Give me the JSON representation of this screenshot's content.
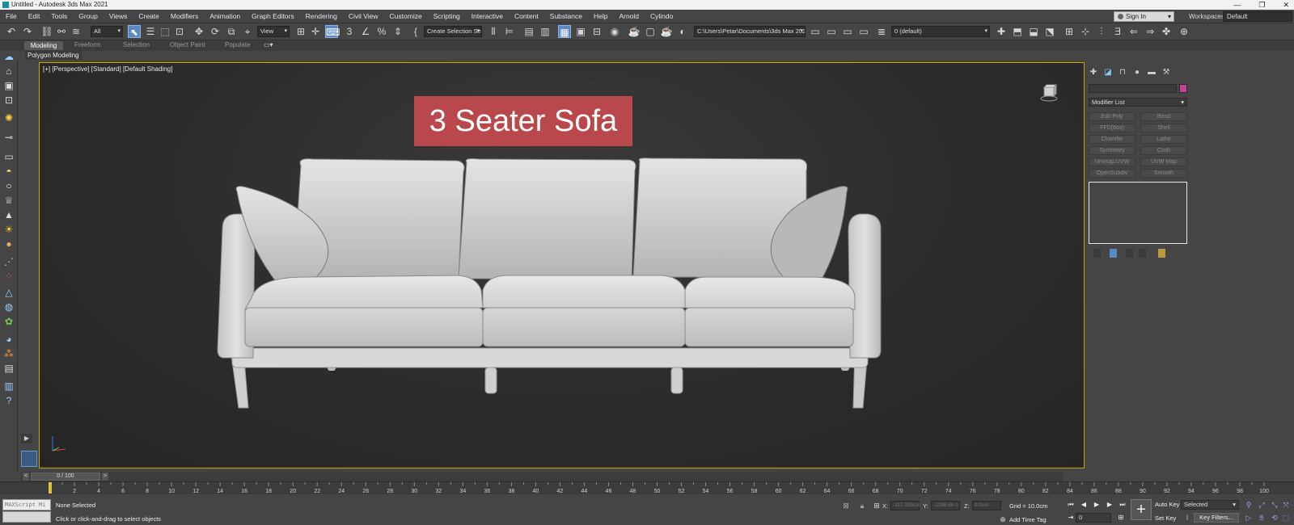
{
  "title_bar": {
    "title": "Untitled - Autodesk 3ds Max 2021",
    "minimize": "—",
    "restore": "❐",
    "close": "✕"
  },
  "menu": [
    "File",
    "Edit",
    "Tools",
    "Group",
    "Views",
    "Create",
    "Modifiers",
    "Animation",
    "Graph Editors",
    "Rendering",
    "Civil View",
    "Customize",
    "Scripting",
    "Interactive",
    "Content",
    "Substance",
    "Help",
    "Arnold",
    "Cylindo"
  ],
  "account": {
    "sign_in": "Sign In",
    "workspaces_label": "Workspaces:",
    "workspace": "Default"
  },
  "toolbar": {
    "selection_filter": "All",
    "ref_coord": "View",
    "named_selection": "Create Selection Se",
    "project_path": "C:\\Users\\Petar\\Documents\\3ds Max 2021",
    "layer": "0 (default)",
    "snap_label": "3",
    "angle_snap_label": "∠",
    "percent_snap_label": "%"
  },
  "ribbon": {
    "tabs": [
      "Modeling",
      "Freeform",
      "Selection",
      "Object Paint",
      "Populate"
    ],
    "sub_label": "Polygon Modeling"
  },
  "viewport": {
    "label": "[+] [Perspective] [Standard] [Default Shading]",
    "overlay_title": "3 Seater Sofa",
    "cube_label": "FRONT"
  },
  "command_panel": {
    "modifier_list": "Modifier List",
    "buttons": [
      "Edit Poly",
      "Bend",
      "FFD(box)",
      "Shell",
      "Chamfer",
      "Lathe",
      "Symmetry",
      "Cloth",
      "Unwrap UVW",
      "UVW Map",
      "OpenSubdiv",
      "Smooth"
    ]
  },
  "timeline": {
    "frame_display": "0 / 100",
    "ticks": [
      "0",
      "2",
      "4",
      "6",
      "8",
      "10",
      "12",
      "14",
      "16",
      "18",
      "20",
      "22",
      "24",
      "26",
      "28",
      "30",
      "32",
      "34",
      "36",
      "38",
      "40",
      "42",
      "44",
      "46",
      "48",
      "50",
      "52",
      "54",
      "56",
      "58",
      "60",
      "62",
      "64",
      "66",
      "68",
      "70",
      "72",
      "74",
      "76",
      "78",
      "80",
      "82",
      "84",
      "86",
      "88",
      "90",
      "92",
      "94",
      "96",
      "98",
      "100"
    ]
  },
  "status": {
    "maxscript": "MAXScript Mi",
    "selection": "None Selected",
    "prompt": "Click or click-and-drag to select objects",
    "x_label": "X:",
    "x_value": "-117.985cm",
    "y_label": "Y:",
    "y_value": "-1298.66 c",
    "z_label": "Z:",
    "z_value": "0.0cm",
    "grid": "Grid = 10.0cm",
    "add_time_tag": "Add Time Tag",
    "frame": "0",
    "auto_key": "Auto Key",
    "set_key": "Set Key",
    "selected_set": "Selected",
    "key_filters": "Key Filters..."
  },
  "colors": {
    "viewport_border": "#c7a700",
    "title_box": "#b8484b",
    "active_tool": "#5b88c0"
  }
}
